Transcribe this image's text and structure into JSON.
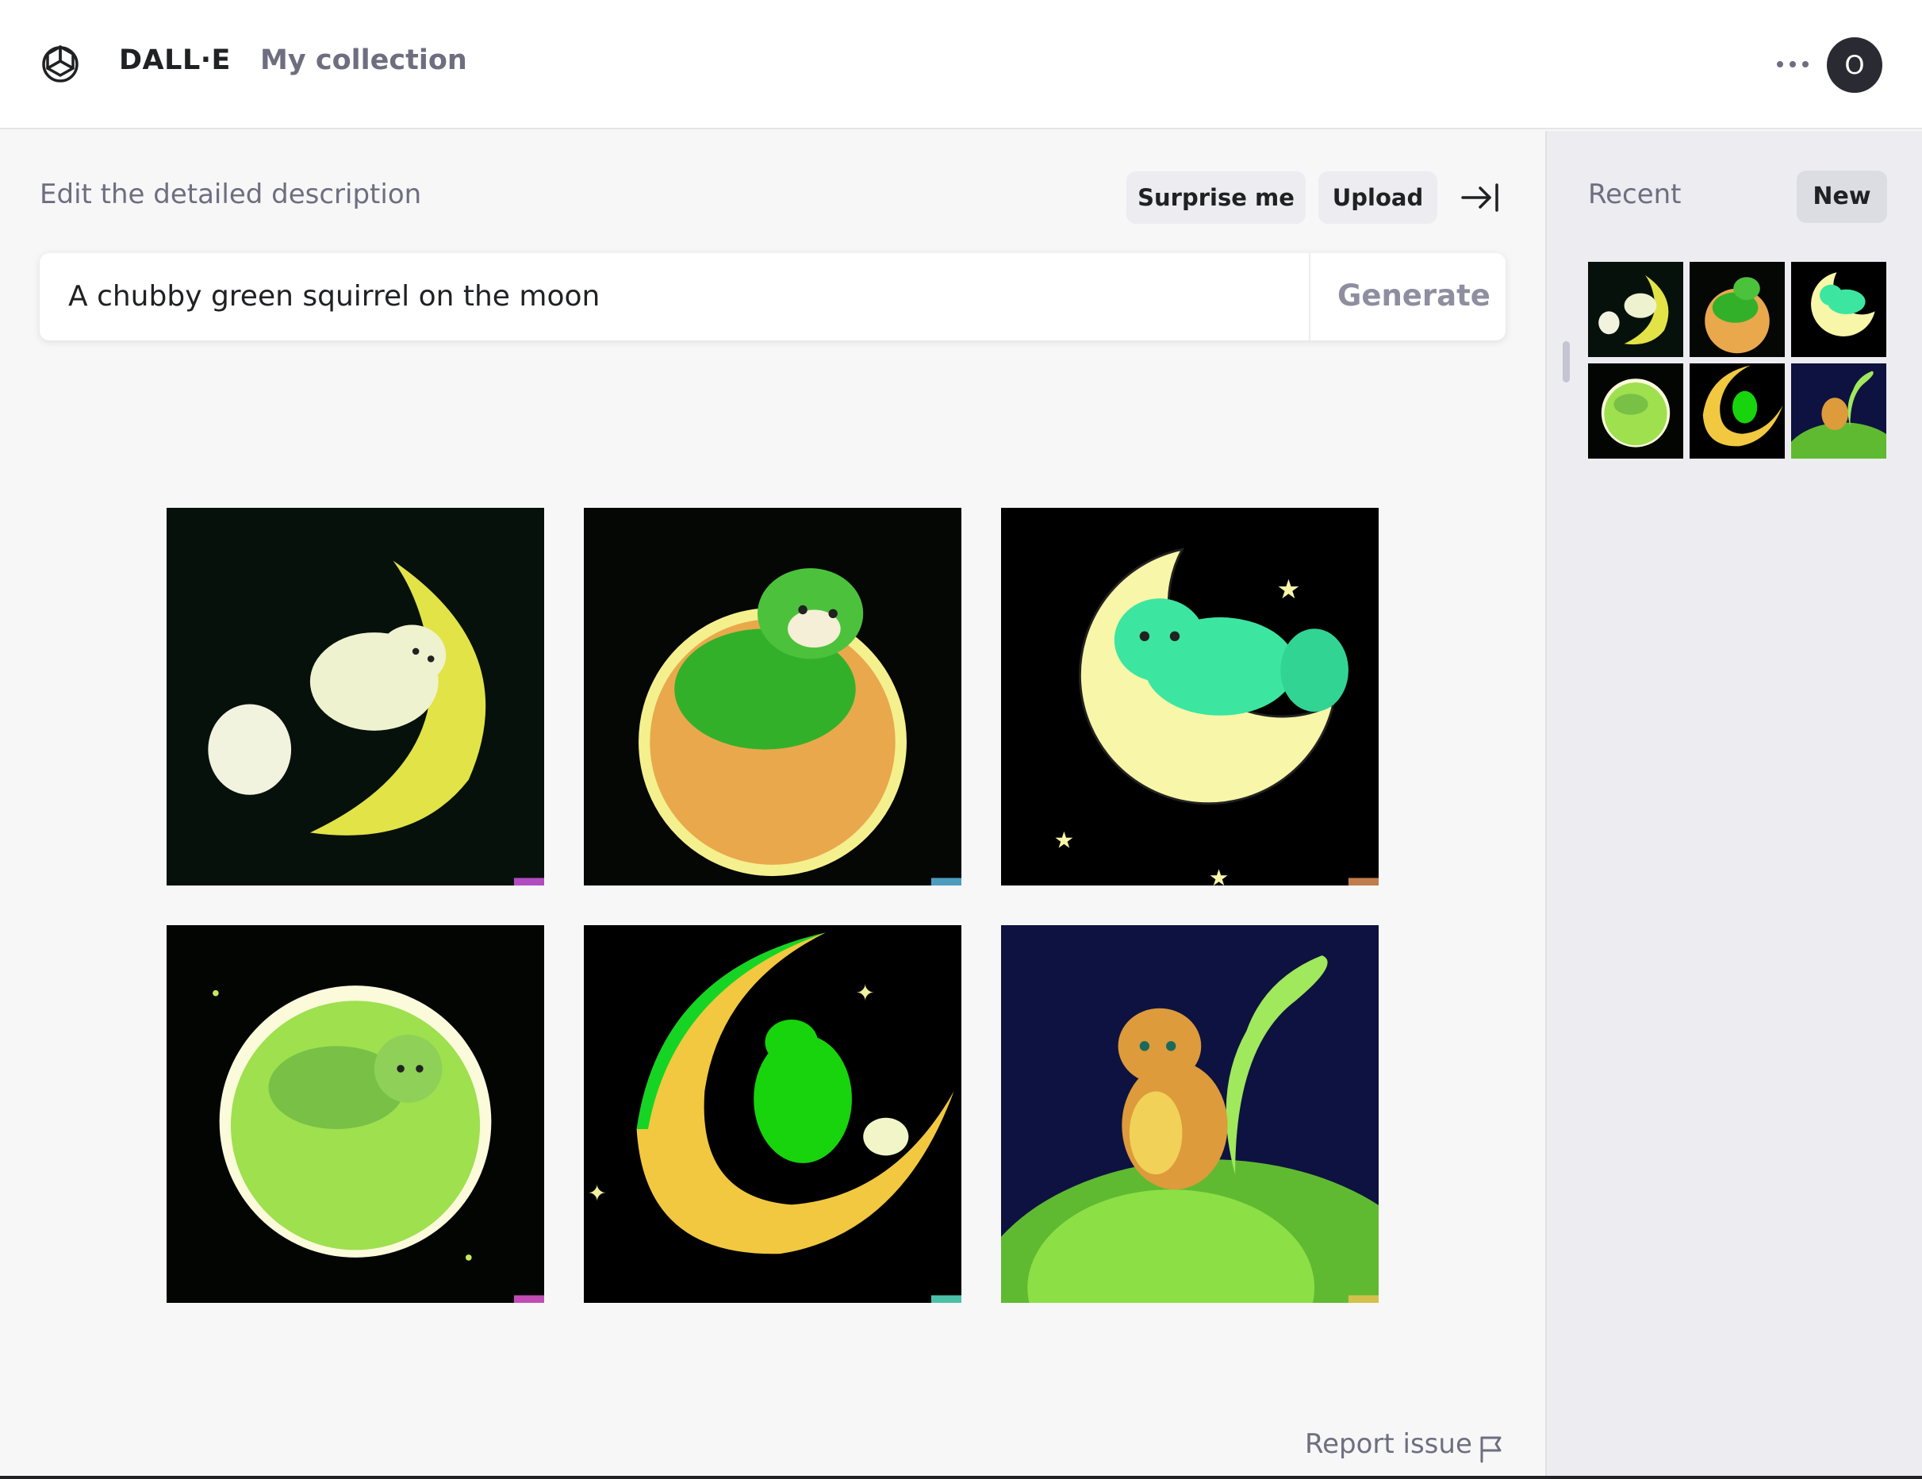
{
  "header": {
    "brand": "DALL·E",
    "collection_link": "My collection",
    "avatar_initial": "O",
    "more_icon": "more-horizontal-icon",
    "logo_icon": "openai-logo-icon"
  },
  "editor": {
    "description_label": "Edit the detailed description",
    "surprise_label": "Surprise me",
    "upload_label": "Upload",
    "collapse_icon": "collapse-sidebar-icon",
    "prompt_value": "A chubby green squirrel on the moon",
    "generate_label": "Generate"
  },
  "results": [
    {
      "name": "squirrel-crescent-pale"
    },
    {
      "name": "squirrel-orange-moon"
    },
    {
      "name": "squirrel-mint-crescent"
    },
    {
      "name": "squirrel-green-orb"
    },
    {
      "name": "squirrel-yellow-crescent"
    },
    {
      "name": "squirrel-green-planet"
    }
  ],
  "footer": {
    "report_label": "Report issue",
    "report_icon": "flag-icon"
  },
  "sidebar": {
    "recent_label": "Recent",
    "new_label": "New"
  },
  "colors": {
    "accent_dark": "#202123",
    "muted_text": "#6e6e80",
    "pill_bg": "#ececf1"
  }
}
